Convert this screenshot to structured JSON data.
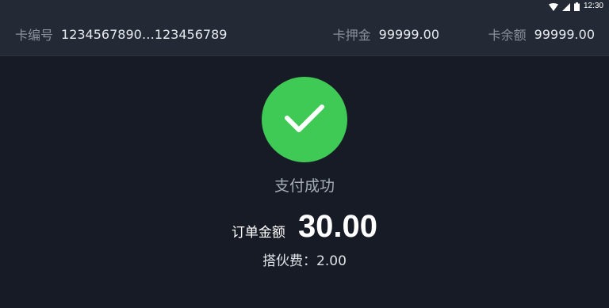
{
  "status_bar": {
    "time": "12:30",
    "icons": [
      "wifi-icon",
      "signal-icon",
      "battery-icon"
    ]
  },
  "card_info": {
    "number_label": "卡编号",
    "number_value": "1234567890…123456789",
    "deposit_label": "卡押金",
    "deposit_value": "99999.00",
    "balance_label": "卡余额",
    "balance_value": "99999.00"
  },
  "result": {
    "icon": "checkmark-icon",
    "status_text": "支付成功",
    "amount_label": "订单金额",
    "amount_value": "30.00",
    "fee_text": "搭伙费：2.00"
  },
  "colors": {
    "background": "#161b25",
    "bar": "#232a35",
    "success": "#3fc955"
  }
}
